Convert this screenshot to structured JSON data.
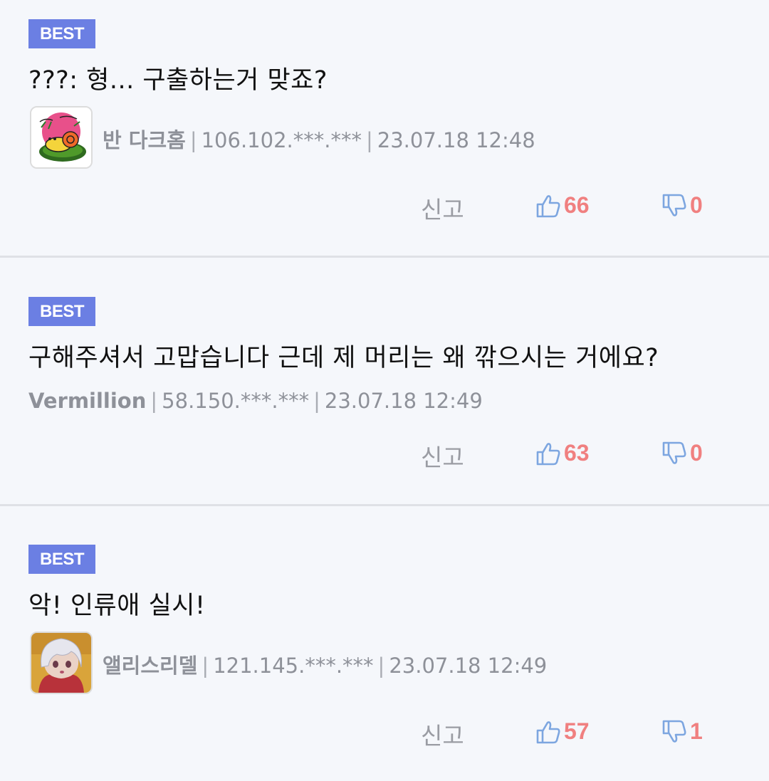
{
  "colors": {
    "badge": "#6b7fe3",
    "count": "#f08080",
    "thumb": "#7da6e0",
    "meta": "#8e9199",
    "background": "#f5f7fb"
  },
  "comments": [
    {
      "badge": "BEST",
      "text": "???: 형... 구출하는거 맞죠?",
      "has_avatar": true,
      "avatar_icon": "cartoon-snail-avatar",
      "nickname": "반 다크홈",
      "ip": "106.102.***.***",
      "date": "23.07.18 12:48",
      "report_label": "신고",
      "upvotes": "66",
      "downvotes": "0"
    },
    {
      "badge": "BEST",
      "text": "구해주셔서 고맙습니다 근데 제 머리는 왜 깎으시는 거에요?",
      "has_avatar": false,
      "nickname": "Vermillion",
      "ip": "58.150.***.***",
      "date": "23.07.18 12:49",
      "report_label": "신고",
      "upvotes": "63",
      "downvotes": "0"
    },
    {
      "badge": "BEST",
      "text": "악! 인류애 실시!",
      "has_avatar": true,
      "avatar_icon": "anime-girl-avatar",
      "nickname": "앨리스리델",
      "ip": "121.145.***.***",
      "date": "23.07.18 12:49",
      "report_label": "신고",
      "upvotes": "57",
      "downvotes": "1"
    }
  ]
}
